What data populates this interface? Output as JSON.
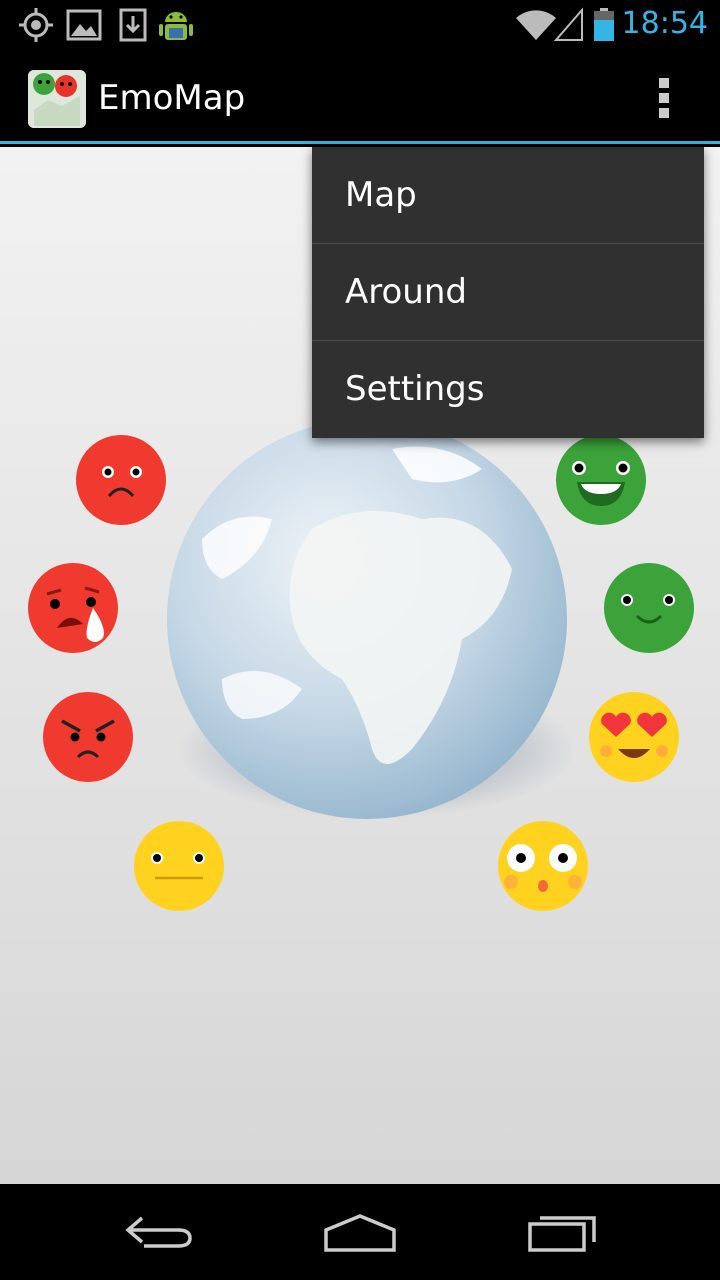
{
  "status_bar": {
    "time": "18:54",
    "icons": [
      "gps-icon",
      "gallery-icon",
      "download-icon",
      "android-icon",
      "wifi-icon",
      "signal-icon",
      "battery-icon"
    ]
  },
  "action_bar": {
    "title": "EmoMap",
    "app_icon": "emomap-app-icon",
    "overflow_icon": "overflow-menu-icon"
  },
  "menu": {
    "items": [
      {
        "label": "Map"
      },
      {
        "label": "Around"
      },
      {
        "label": "Settings"
      }
    ]
  },
  "emotions": [
    {
      "name": "sad",
      "color": "#f03a30"
    },
    {
      "name": "crying",
      "color": "#f03a30"
    },
    {
      "name": "angry",
      "color": "#f03a30"
    },
    {
      "name": "neutral",
      "color": "#ffd21f"
    },
    {
      "name": "happy",
      "color": "#3ba33a"
    },
    {
      "name": "smile",
      "color": "#3ba33a"
    },
    {
      "name": "love",
      "color": "#ffd21f"
    },
    {
      "name": "surprised",
      "color": "#ffd21f"
    }
  ],
  "colors": {
    "accent": "#33b5e5",
    "menu_bg": "#303030"
  },
  "nav_bar": {
    "icons": [
      "back-icon",
      "home-icon",
      "recents-icon"
    ]
  }
}
